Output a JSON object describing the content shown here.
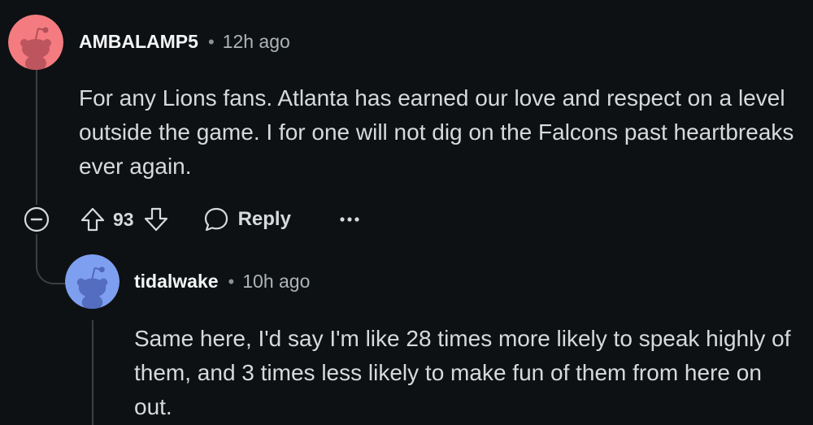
{
  "comment": {
    "username": "AMBALAMP5",
    "separator": "•",
    "timestamp": "12h ago",
    "body": "For any Lions fans. Atlanta has earned our love and respect on a level outside the game. I for one will not dig on the Falcons past heartbreaks ever again.",
    "score": "93",
    "reply_label": "Reply",
    "avatar_color": "#f47b80"
  },
  "reply": {
    "username": "tidalwake",
    "separator": "•",
    "timestamp": "10h ago",
    "body": "Same here, I'd say I'm like 28 times more likely to speak highly of them, and 3 times less likely to make fun of them from here on out.",
    "avatar_color": "#7e9ff0"
  },
  "icons": {
    "upvote": "upvote-icon",
    "downvote": "downvote-icon",
    "reply": "speech-bubble-icon",
    "more": "ellipsis-icon",
    "collapse": "minus-circle-icon"
  },
  "colors": {
    "background": "#0e1113",
    "thread_line": "#3a3f43",
    "text": "#d7dadc"
  }
}
